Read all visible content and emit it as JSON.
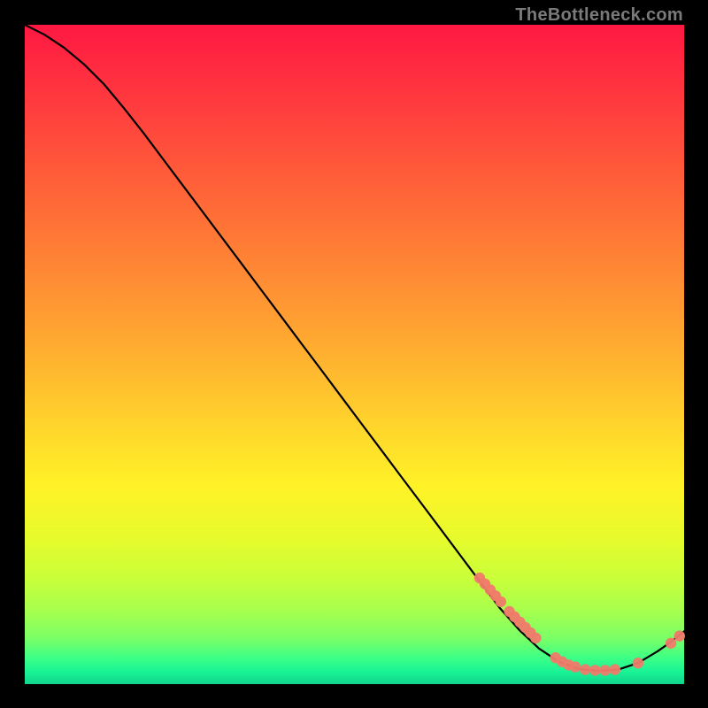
{
  "watermark": "TheBottleneck.com",
  "chart_data": {
    "type": "line",
    "title": "",
    "xlabel": "",
    "ylabel": "",
    "xlim": [
      0,
      100
    ],
    "ylim": [
      0,
      100
    ],
    "grid": false,
    "note": "No axis ticks or labels are visible; values are percent of plot area.",
    "curve_points_percent": [
      [
        0,
        100
      ],
      [
        3,
        98.5
      ],
      [
        6,
        96.5
      ],
      [
        9,
        94
      ],
      [
        12,
        91
      ],
      [
        15,
        87.4
      ],
      [
        18,
        83.6
      ],
      [
        21,
        79.6
      ],
      [
        24,
        75.6
      ],
      [
        27,
        71.6
      ],
      [
        30,
        67.6
      ],
      [
        33,
        63.6
      ],
      [
        36,
        59.6
      ],
      [
        39,
        55.6
      ],
      [
        42,
        51.6
      ],
      [
        45,
        47.6
      ],
      [
        48,
        43.6
      ],
      [
        51,
        39.6
      ],
      [
        54,
        35.6
      ],
      [
        57,
        31.6
      ],
      [
        60,
        27.6
      ],
      [
        63,
        23.6
      ],
      [
        66,
        19.6
      ],
      [
        69,
        15.6
      ],
      [
        72,
        11.6
      ],
      [
        75,
        8.2
      ],
      [
        78,
        5.4
      ],
      [
        81,
        3.4
      ],
      [
        84,
        2.3
      ],
      [
        87,
        2.0
      ],
      [
        90,
        2.2
      ],
      [
        93,
        3.2
      ],
      [
        96,
        5.0
      ],
      [
        98,
        6.4
      ],
      [
        100,
        8.0
      ]
    ],
    "marker_clusters_percent": [
      [
        69,
        16.1
      ],
      [
        69.8,
        15.2
      ],
      [
        70.6,
        14.3
      ],
      [
        71.4,
        13.4
      ],
      [
        72.2,
        12.5
      ],
      [
        73.5,
        11.0
      ],
      [
        74.3,
        10.2
      ],
      [
        75.1,
        9.4
      ],
      [
        75.9,
        8.6
      ],
      [
        76.7,
        7.8
      ],
      [
        77.5,
        7.0
      ],
      [
        80.5,
        4.0
      ],
      [
        81.5,
        3.4
      ],
      [
        82.5,
        2.9
      ],
      [
        83.5,
        2.6
      ],
      [
        85.0,
        2.2
      ],
      [
        86.5,
        2.1
      ],
      [
        88.0,
        2.1
      ],
      [
        89.5,
        2.2
      ],
      [
        93.0,
        3.2
      ],
      [
        98.0,
        6.2
      ],
      [
        99.3,
        7.3
      ]
    ]
  }
}
